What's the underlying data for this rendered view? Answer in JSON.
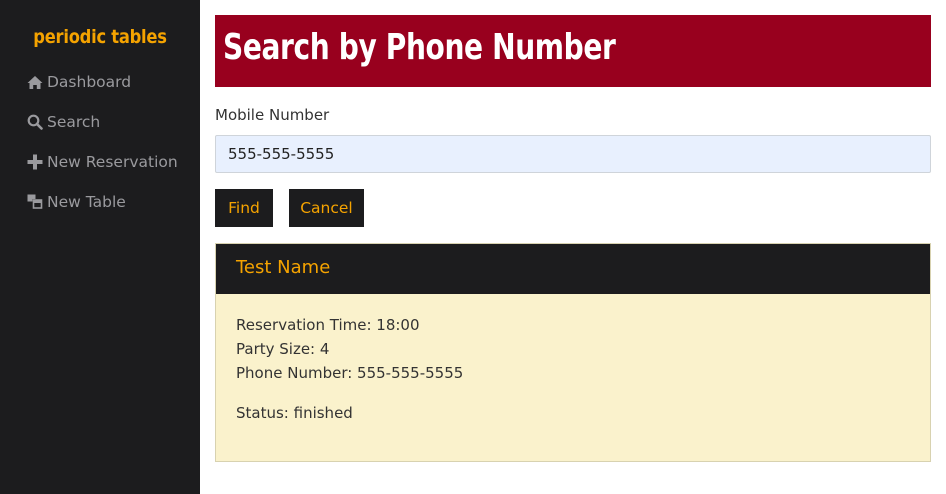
{
  "sidebar": {
    "brand": "periodic tables",
    "items": [
      {
        "label": "Dashboard",
        "icon": "home-icon"
      },
      {
        "label": "Search",
        "icon": "search-icon"
      },
      {
        "label": "New Reservation",
        "icon": "plus-icon"
      },
      {
        "label": "New Table",
        "icon": "table-icon"
      }
    ]
  },
  "main": {
    "title": "Search by Phone Number",
    "form": {
      "label": "Mobile Number",
      "value": "555-555-5555",
      "find_label": "Find",
      "cancel_label": "Cancel"
    },
    "result": {
      "name": "Test Name",
      "time_text": "Reservation Time: 18:00",
      "party_text": "Party Size: 4",
      "phone_text": "Phone Number: 555-555-5555",
      "status_text": "Status: finished"
    }
  },
  "colors": {
    "sidebar_bg": "#1c1c1e",
    "accent": "#f5a300",
    "title_bg": "#98001e",
    "card_bg": "#faf2cc",
    "input_bg": "#e8f0fe",
    "nav_text": "#9a9a9e"
  }
}
